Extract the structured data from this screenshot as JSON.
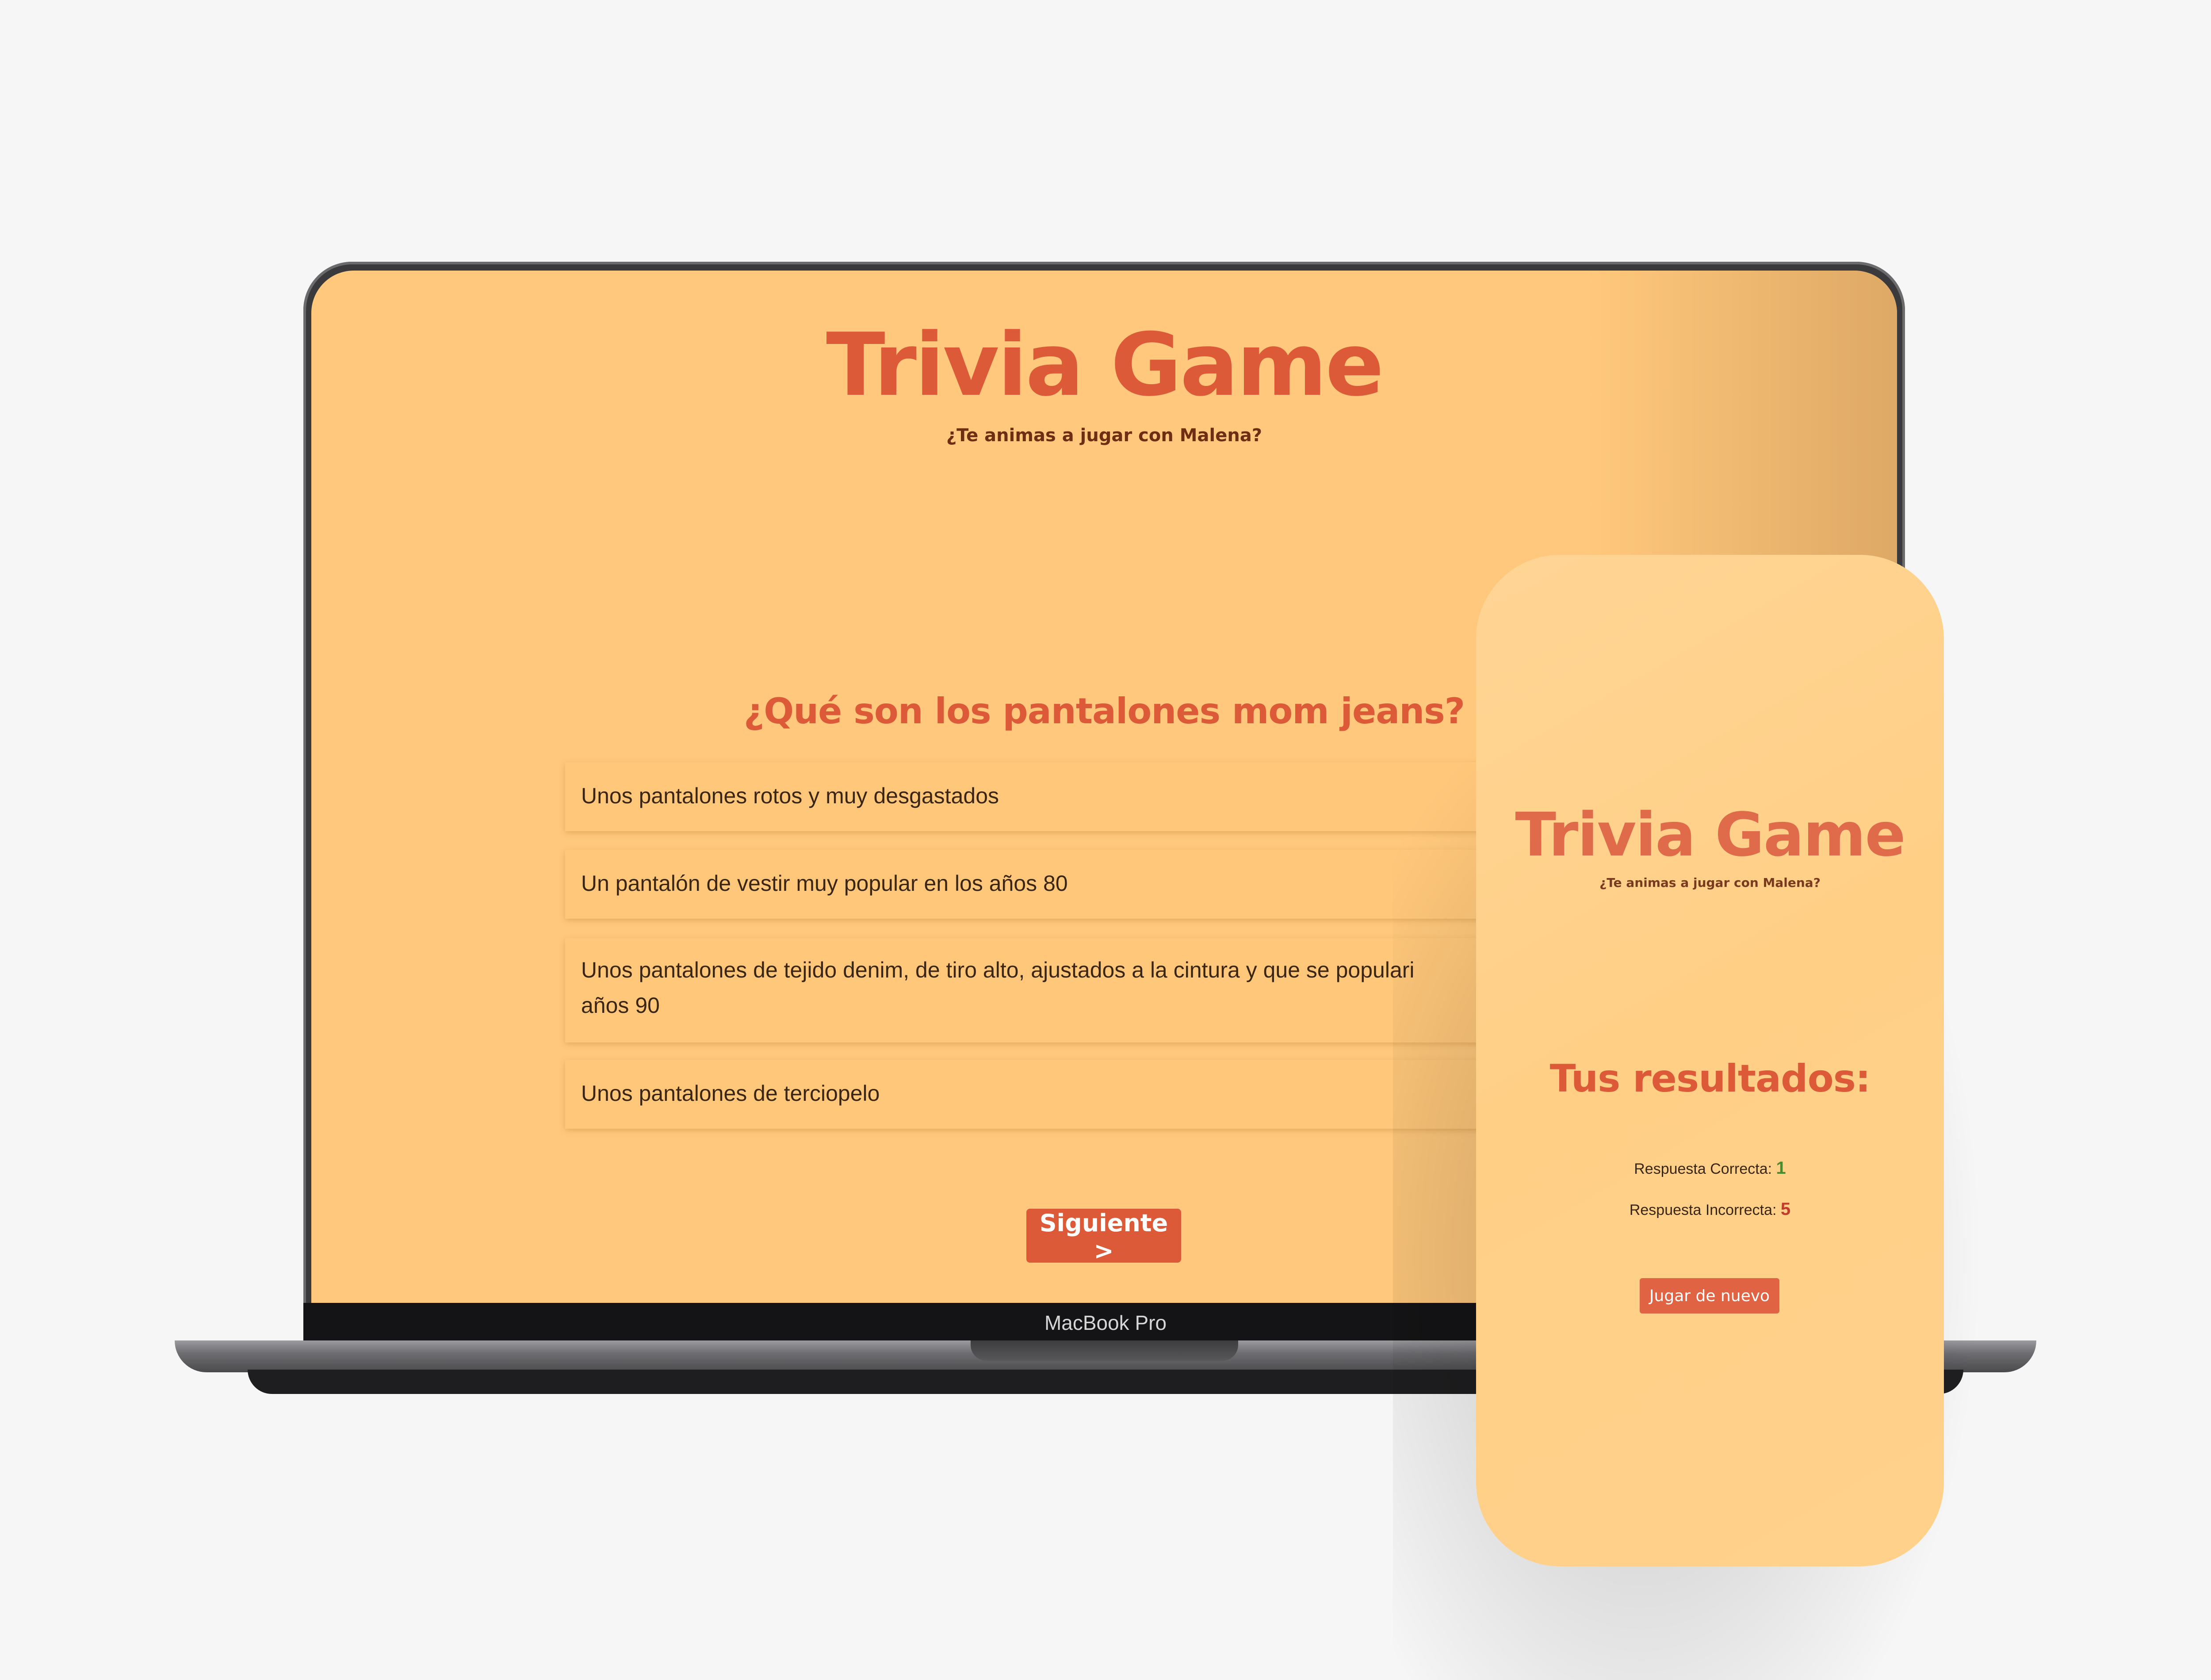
{
  "laptop": {
    "model_label": "MacBook Pro",
    "screen": {
      "title": "Trivia Game",
      "subtitle": "¿Te animas a jugar con Malena?",
      "question": "¿Qué son los pantalones mom jeans?",
      "answers": [
        "Unos pantalones rotos y muy desgastados",
        "Un pantalón de vestir muy popular en los años 80",
        "Unos pantalones de tejido denim, de tiro alto, ajustados a la cintura y que se populari",
        "Unos pantalones de terciopelo"
      ],
      "answer_2_line_2": "años 90",
      "next_button": "Siguiente >"
    }
  },
  "phone": {
    "title": "Trivia Game",
    "subtitle": "¿Te animas a jugar con Malena?",
    "results_heading": "Tus resultados:",
    "correct_label": "Respuesta Correcta:",
    "correct_value": "1",
    "incorrect_label": "Respuesta Incorrecta:",
    "incorrect_value": "5",
    "play_again_button": "Jugar de nuevo"
  },
  "colors": {
    "accent": "#dd5a38",
    "screen_bg": "#ffc87c",
    "phone_bg": "#ffd595",
    "correct": "#4b8a2e",
    "incorrect": "#c23a2c"
  }
}
